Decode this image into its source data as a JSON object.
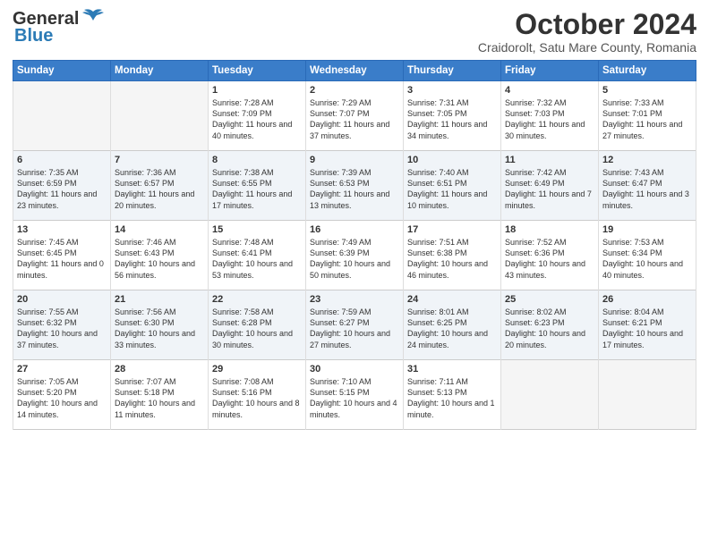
{
  "logo": {
    "line1": "General",
    "line2": "Blue"
  },
  "title": "October 2024",
  "subtitle": "Craidorolt, Satu Mare County, Romania",
  "days_of_week": [
    "Sunday",
    "Monday",
    "Tuesday",
    "Wednesday",
    "Thursday",
    "Friday",
    "Saturday"
  ],
  "weeks": [
    [
      {
        "day": "",
        "info": ""
      },
      {
        "day": "",
        "info": ""
      },
      {
        "day": "1",
        "info": "Sunrise: 7:28 AM\nSunset: 7:09 PM\nDaylight: 11 hours and 40 minutes."
      },
      {
        "day": "2",
        "info": "Sunrise: 7:29 AM\nSunset: 7:07 PM\nDaylight: 11 hours and 37 minutes."
      },
      {
        "day": "3",
        "info": "Sunrise: 7:31 AM\nSunset: 7:05 PM\nDaylight: 11 hours and 34 minutes."
      },
      {
        "day": "4",
        "info": "Sunrise: 7:32 AM\nSunset: 7:03 PM\nDaylight: 11 hours and 30 minutes."
      },
      {
        "day": "5",
        "info": "Sunrise: 7:33 AM\nSunset: 7:01 PM\nDaylight: 11 hours and 27 minutes."
      }
    ],
    [
      {
        "day": "6",
        "info": "Sunrise: 7:35 AM\nSunset: 6:59 PM\nDaylight: 11 hours and 23 minutes."
      },
      {
        "day": "7",
        "info": "Sunrise: 7:36 AM\nSunset: 6:57 PM\nDaylight: 11 hours and 20 minutes."
      },
      {
        "day": "8",
        "info": "Sunrise: 7:38 AM\nSunset: 6:55 PM\nDaylight: 11 hours and 17 minutes."
      },
      {
        "day": "9",
        "info": "Sunrise: 7:39 AM\nSunset: 6:53 PM\nDaylight: 11 hours and 13 minutes."
      },
      {
        "day": "10",
        "info": "Sunrise: 7:40 AM\nSunset: 6:51 PM\nDaylight: 11 hours and 10 minutes."
      },
      {
        "day": "11",
        "info": "Sunrise: 7:42 AM\nSunset: 6:49 PM\nDaylight: 11 hours and 7 minutes."
      },
      {
        "day": "12",
        "info": "Sunrise: 7:43 AM\nSunset: 6:47 PM\nDaylight: 11 hours and 3 minutes."
      }
    ],
    [
      {
        "day": "13",
        "info": "Sunrise: 7:45 AM\nSunset: 6:45 PM\nDaylight: 11 hours and 0 minutes."
      },
      {
        "day": "14",
        "info": "Sunrise: 7:46 AM\nSunset: 6:43 PM\nDaylight: 10 hours and 56 minutes."
      },
      {
        "day": "15",
        "info": "Sunrise: 7:48 AM\nSunset: 6:41 PM\nDaylight: 10 hours and 53 minutes."
      },
      {
        "day": "16",
        "info": "Sunrise: 7:49 AM\nSunset: 6:39 PM\nDaylight: 10 hours and 50 minutes."
      },
      {
        "day": "17",
        "info": "Sunrise: 7:51 AM\nSunset: 6:38 PM\nDaylight: 10 hours and 46 minutes."
      },
      {
        "day": "18",
        "info": "Sunrise: 7:52 AM\nSunset: 6:36 PM\nDaylight: 10 hours and 43 minutes."
      },
      {
        "day": "19",
        "info": "Sunrise: 7:53 AM\nSunset: 6:34 PM\nDaylight: 10 hours and 40 minutes."
      }
    ],
    [
      {
        "day": "20",
        "info": "Sunrise: 7:55 AM\nSunset: 6:32 PM\nDaylight: 10 hours and 37 minutes."
      },
      {
        "day": "21",
        "info": "Sunrise: 7:56 AM\nSunset: 6:30 PM\nDaylight: 10 hours and 33 minutes."
      },
      {
        "day": "22",
        "info": "Sunrise: 7:58 AM\nSunset: 6:28 PM\nDaylight: 10 hours and 30 minutes."
      },
      {
        "day": "23",
        "info": "Sunrise: 7:59 AM\nSunset: 6:27 PM\nDaylight: 10 hours and 27 minutes."
      },
      {
        "day": "24",
        "info": "Sunrise: 8:01 AM\nSunset: 6:25 PM\nDaylight: 10 hours and 24 minutes."
      },
      {
        "day": "25",
        "info": "Sunrise: 8:02 AM\nSunset: 6:23 PM\nDaylight: 10 hours and 20 minutes."
      },
      {
        "day": "26",
        "info": "Sunrise: 8:04 AM\nSunset: 6:21 PM\nDaylight: 10 hours and 17 minutes."
      }
    ],
    [
      {
        "day": "27",
        "info": "Sunrise: 7:05 AM\nSunset: 5:20 PM\nDaylight: 10 hours and 14 minutes."
      },
      {
        "day": "28",
        "info": "Sunrise: 7:07 AM\nSunset: 5:18 PM\nDaylight: 10 hours and 11 minutes."
      },
      {
        "day": "29",
        "info": "Sunrise: 7:08 AM\nSunset: 5:16 PM\nDaylight: 10 hours and 8 minutes."
      },
      {
        "day": "30",
        "info": "Sunrise: 7:10 AM\nSunset: 5:15 PM\nDaylight: 10 hours and 4 minutes."
      },
      {
        "day": "31",
        "info": "Sunrise: 7:11 AM\nSunset: 5:13 PM\nDaylight: 10 hours and 1 minute."
      },
      {
        "day": "",
        "info": ""
      },
      {
        "day": "",
        "info": ""
      }
    ]
  ]
}
